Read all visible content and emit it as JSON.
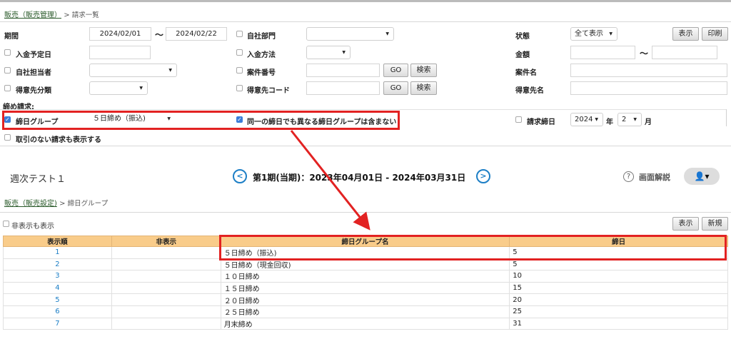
{
  "breadcrumb1": {
    "link": "販売（販売管理）",
    "sep": ">",
    "current": "請求一覧"
  },
  "filters": {
    "period": {
      "label": "期間",
      "from": "2024/02/01",
      "tilde": "〜",
      "to": "2024/02/22"
    },
    "dept": {
      "label": "自社部門"
    },
    "status": {
      "label": "状態",
      "value": "全て表示"
    },
    "show_button": "表示",
    "print_button": "印刷",
    "due_date": {
      "label": "入金予定日"
    },
    "pay_method": {
      "label": "入金方法"
    },
    "amount": {
      "label": "金額",
      "tilde": "〜"
    },
    "staff": {
      "label": "自社担当者"
    },
    "case_no": {
      "label": "案件番号",
      "go": "GO",
      "search": "検索"
    },
    "case_name": {
      "label": "案件名"
    },
    "cust_cat": {
      "label": "得意先分類"
    },
    "cust_code": {
      "label": "得意先コード",
      "go": "GO",
      "search": "検索"
    },
    "cust_name": {
      "label": "得意先名"
    },
    "closing_section": "締め請求:",
    "closing_group": {
      "label": "締日グループ",
      "value": "５日締め（振込)"
    },
    "exclude_option": {
      "label": "同一の締日でも異なる締日グループは含まない"
    },
    "bill_close": {
      "label": "請求締日",
      "year": "2024",
      "year_unit": "年",
      "month": "2",
      "month_unit": "月"
    },
    "no_tx": {
      "label": "取引のない請求も表示する"
    }
  },
  "context_bar": {
    "title": "週次テスト１",
    "period": "第1期(当期)：2023年04月01日 - 2024年03月31日",
    "help": "画面解説"
  },
  "breadcrumb2": {
    "link": "販売（販売設定)",
    "sep": ">",
    "current": "締日グループ"
  },
  "group_list": {
    "hidden_toggle": "非表示も表示",
    "show_button": "表示",
    "new_button": "新規",
    "headers": [
      "表示順",
      "非表示",
      "締日グループ名",
      "締日"
    ],
    "rows": [
      {
        "order": "1",
        "hidden": "",
        "name": "５日締め（振込)",
        "day": "5"
      },
      {
        "order": "2",
        "hidden": "",
        "name": "５日締め（現金回収)",
        "day": "5"
      },
      {
        "order": "3",
        "hidden": "",
        "name": "１０日締め",
        "day": "10"
      },
      {
        "order": "4",
        "hidden": "",
        "name": "１５日締め",
        "day": "15"
      },
      {
        "order": "5",
        "hidden": "",
        "name": "２０日締め",
        "day": "20"
      },
      {
        "order": "6",
        "hidden": "",
        "name": "２５日締め",
        "day": "25"
      },
      {
        "order": "7",
        "hidden": "",
        "name": "月末締め",
        "day": "31"
      }
    ]
  },
  "colors": {
    "accent_red": "#e22222",
    "header_orange": "#f9cc8a",
    "link_blue": "#1d7fc6"
  }
}
